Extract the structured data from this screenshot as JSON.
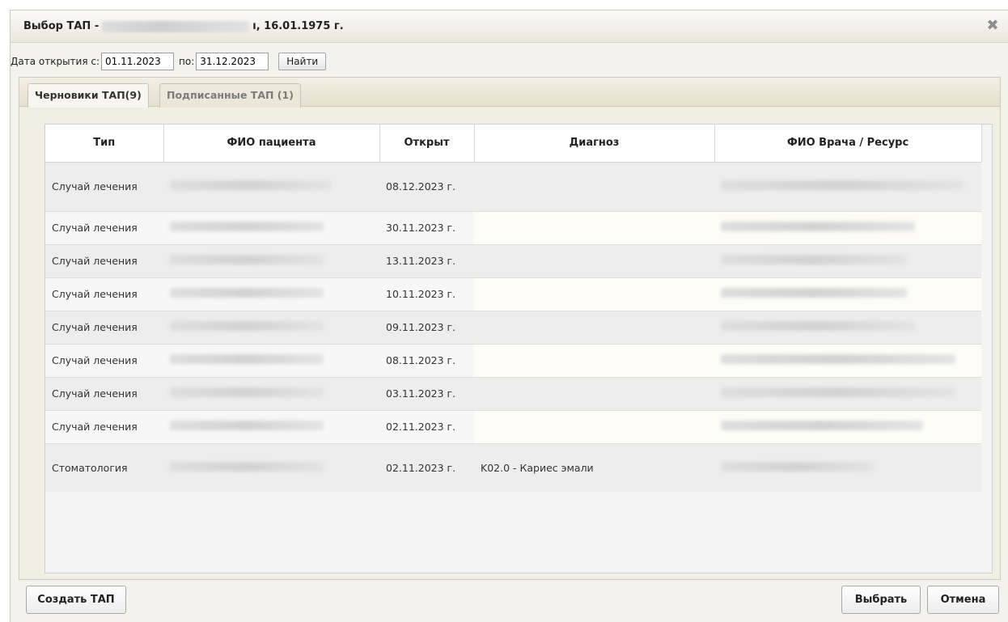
{
  "dialog": {
    "title_prefix": "Выбор ТАП -",
    "title_suffix": "ı, 16.01.1975 г.",
    "close_glyph": "✖"
  },
  "filter": {
    "from_label": "Дата открытия с:",
    "from_value": "01.11.2023",
    "to_label": "по:",
    "to_value": "31.12.2023",
    "find_label": "Найти"
  },
  "tabs": [
    {
      "label": "Черновики ТАП(9)",
      "active": true
    },
    {
      "label": "Подписанные ТАП (1)",
      "active": false
    }
  ],
  "table": {
    "columns": [
      "Тип",
      "ФИО пациента",
      "Открыт",
      "Диагноз",
      "ФИО Врача / Ресурс"
    ],
    "rows": [
      {
        "type": "Случай лечения",
        "opened": "08.12.2023 г.",
        "diagnosis": ""
      },
      {
        "type": "Случай лечения",
        "opened": "30.11.2023 г.",
        "diagnosis": ""
      },
      {
        "type": "Случай лечения",
        "opened": "13.11.2023 г.",
        "diagnosis": ""
      },
      {
        "type": "Случай лечения",
        "opened": "10.11.2023 г.",
        "diagnosis": ""
      },
      {
        "type": "Случай лечения",
        "opened": "09.11.2023 г.",
        "diagnosis": ""
      },
      {
        "type": "Случай лечения",
        "opened": "08.11.2023 г.",
        "diagnosis": ""
      },
      {
        "type": "Случай лечения",
        "opened": "03.11.2023 г.",
        "diagnosis": ""
      },
      {
        "type": "Случай лечения",
        "opened": "02.11.2023 г.",
        "diagnosis": ""
      },
      {
        "type": "Стоматология",
        "opened": "02.11.2023 г.",
        "diagnosis": "K02.0 - Кариес эмали"
      }
    ]
  },
  "footer": {
    "create_label": "Создать ТАП",
    "select_label": "Выбрать",
    "cancel_label": "Отмена"
  }
}
